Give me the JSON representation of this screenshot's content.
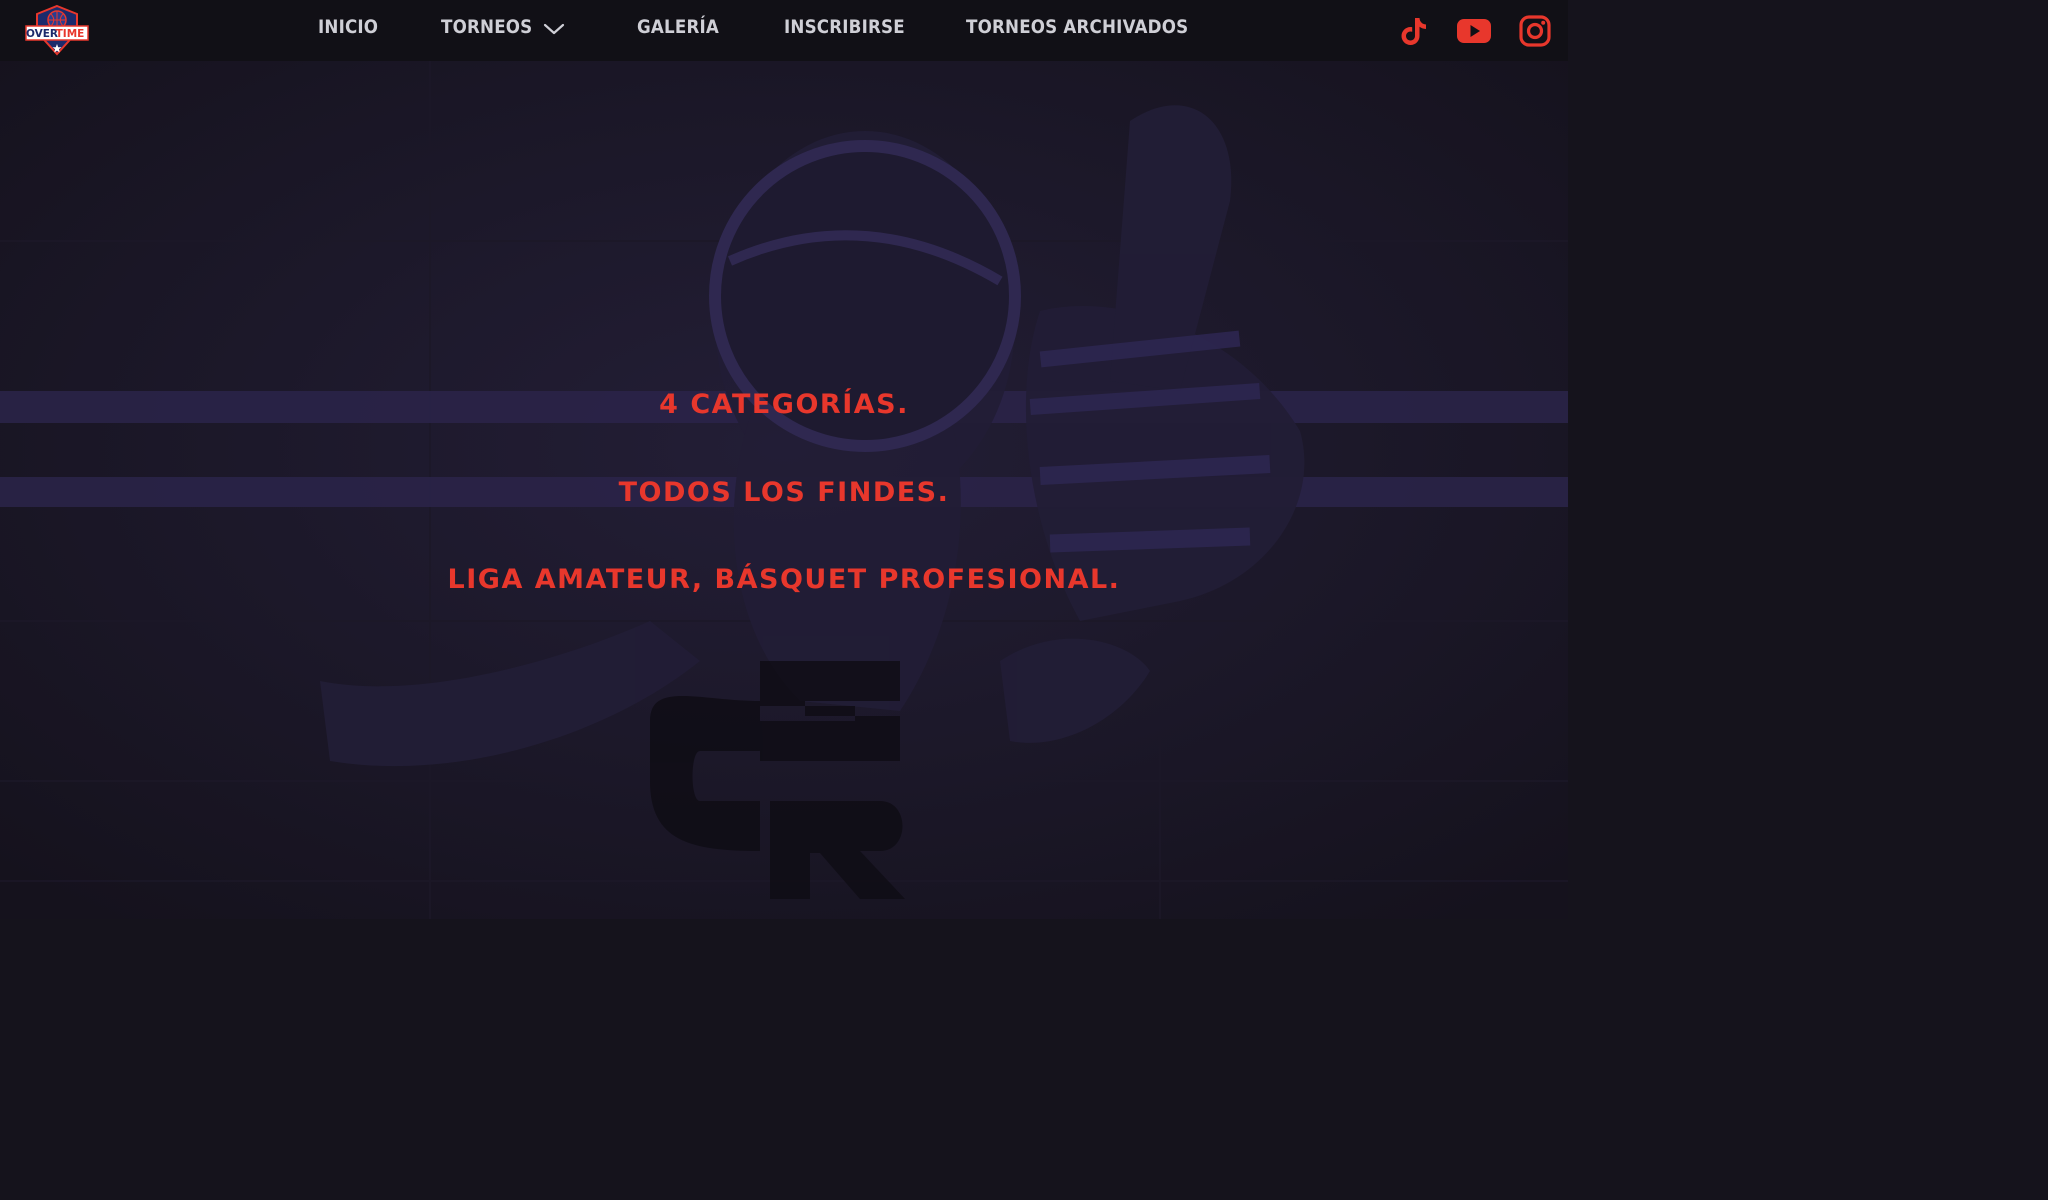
{
  "brand": {
    "logo_text_left": "OVER",
    "logo_text_right": "TIME",
    "accent": "#e8372c",
    "nav_text_color": "#cfcfd6",
    "header_bg": "#111016",
    "hero_tint": "#2a2348"
  },
  "nav": {
    "items": [
      {
        "label": "INICIO"
      },
      {
        "label": "TORNEOS",
        "has_dropdown": true,
        "icon": "chevron-down-icon"
      },
      {
        "label": "GALERÍA"
      },
      {
        "label": "INSCRIBIRSE"
      },
      {
        "label": "TORNEOS ARCHIVADOS"
      }
    ]
  },
  "social": [
    {
      "icon": "tiktok-icon"
    },
    {
      "icon": "youtube-icon"
    },
    {
      "icon": "instagram-icon"
    }
  ],
  "hero": {
    "lines": [
      "4 CATEGORÍAS.",
      "TODOS LOS FINDES.",
      "LIGA AMATEUR, BÁSQUET PROFESIONAL."
    ]
  }
}
